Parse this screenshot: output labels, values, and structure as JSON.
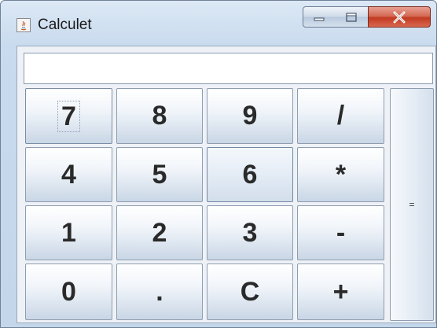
{
  "window": {
    "title": "Calculet",
    "icon": "java-app-icon"
  },
  "display": {
    "value": ""
  },
  "keys": {
    "k7": "7",
    "k8": "8",
    "k9": "9",
    "kdiv": "/",
    "k4": "4",
    "k5": "5",
    "k6": "6",
    "kmul": "*",
    "k1": "1",
    "k2": "2",
    "k3": "3",
    "ksub": "-",
    "k0": "0",
    "kdot": ".",
    "kclr": "C",
    "kadd": "+",
    "keq": "="
  },
  "colors": {
    "close_button": "#c23a22",
    "window_frame": "#c9dbee",
    "client_background": "#eef2f7"
  }
}
